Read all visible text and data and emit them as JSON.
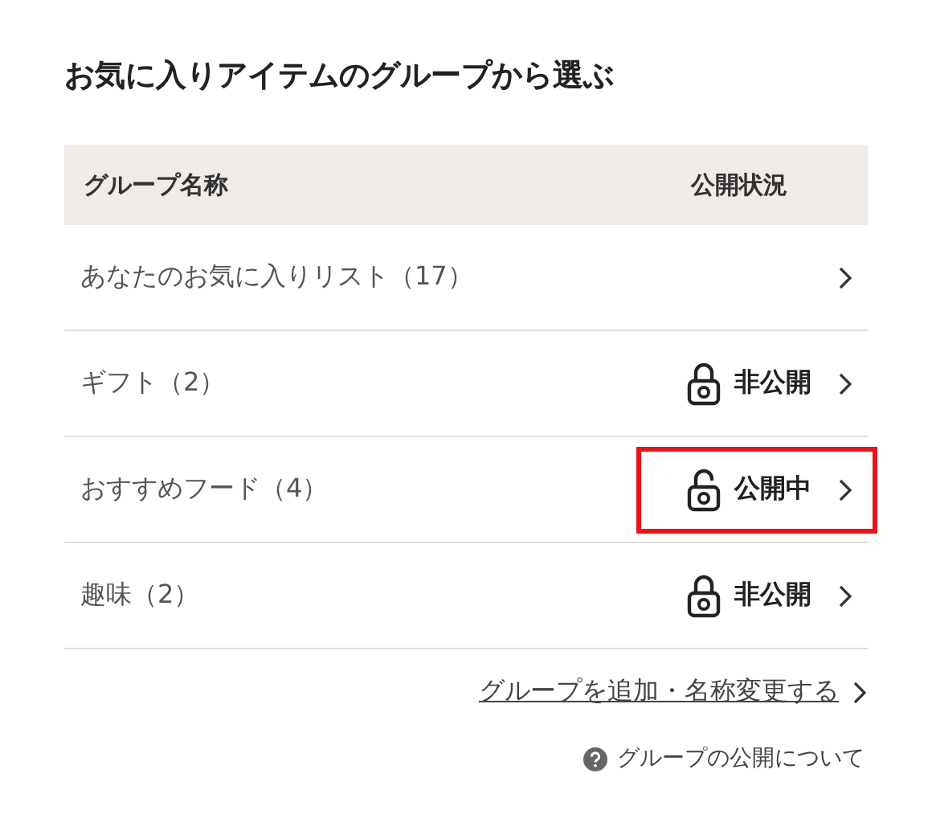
{
  "title": "お気に入りアイテムのグループから選ぶ",
  "table": {
    "columns": [
      "グループ名称",
      "公開状況"
    ],
    "rows": [
      {
        "name": "あなたのお気に入りリスト（17）",
        "highlighted": false
      },
      {
        "name": "ギフト（2）",
        "status": {
          "label": "非公開",
          "locked": true
        },
        "highlighted": false
      },
      {
        "name": "おすすめフード（4）",
        "status": {
          "label": "公開中",
          "locked": false
        },
        "highlighted": true
      },
      {
        "name": "趣味（2）",
        "status": {
          "label": "非公開",
          "locked": true
        },
        "highlighted": false
      }
    ]
  },
  "edit_link": "グループを追加・名称変更する",
  "help_link": "グループの公開について"
}
